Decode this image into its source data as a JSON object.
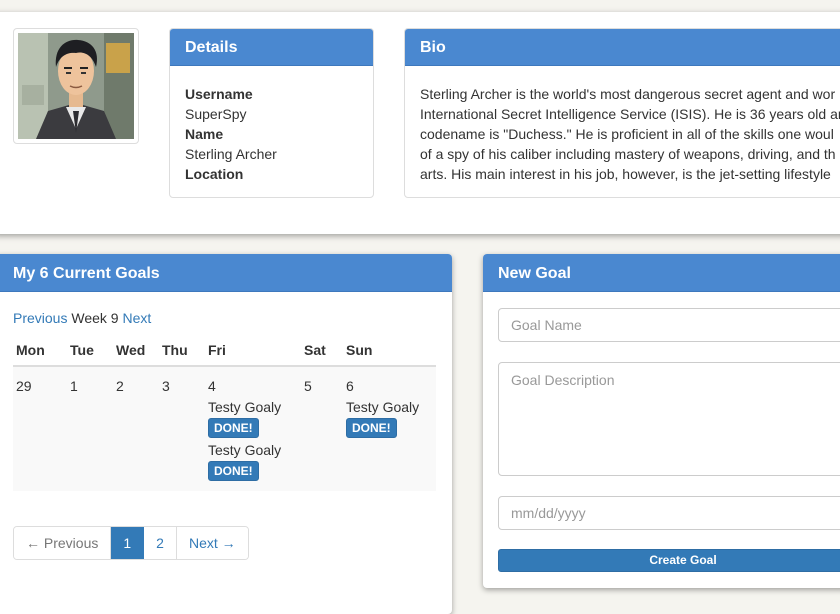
{
  "profile": {
    "details_title": "Details",
    "username_label": "Username",
    "username": "SuperSpy",
    "name_label": "Name",
    "name": "Sterling Archer",
    "location_label": "Location",
    "location": "",
    "bio_title": "Bio",
    "bio_lines": [
      "Sterling Archer is the world's most dangerous secret agent and wor",
      "International Secret Intelligence Service (ISIS). He is 36 years old ar",
      "codename is \"Duchess.\" He is proficient in all of the skills one woul",
      "of a spy of his caliber including mastery of weapons, driving, and th",
      "arts. His main interest in his job, however, is the jet-setting lifestyle"
    ]
  },
  "goals": {
    "title": "My 6 Current Goals",
    "prev_week": "Previous",
    "week_label": "Week 9",
    "next_week": "Next",
    "days": [
      {
        "name": "Mon",
        "date": "29",
        "goals": []
      },
      {
        "name": "Tue",
        "date": "1",
        "goals": []
      },
      {
        "name": "Wed",
        "date": "2",
        "goals": []
      },
      {
        "name": "Thu",
        "date": "3",
        "goals": []
      },
      {
        "name": "Fri",
        "date": "4",
        "goals": [
          {
            "title": "Testy Goaly",
            "button": "DONE!"
          },
          {
            "title": "Testy Goaly",
            "button": "DONE!"
          }
        ]
      },
      {
        "name": "Sat",
        "date": "5",
        "goals": []
      },
      {
        "name": "Sun",
        "date": "6",
        "goals": [
          {
            "title": "Testy Goaly",
            "button": "DONE!"
          }
        ]
      }
    ],
    "pagination": {
      "previous": "← Previous",
      "pages": [
        "1",
        "2"
      ],
      "active_page": "1",
      "next": "Next →"
    }
  },
  "new_goal": {
    "title": "New Goal",
    "name_placeholder": "Goal Name",
    "description_placeholder": "Goal Description",
    "date_placeholder": "mm/dd/yyyy",
    "submit_label": "Create Goal"
  },
  "colors": {
    "panel_header": "#4a88d0",
    "primary": "#337ab7",
    "page_background": "#f5f4ef"
  }
}
